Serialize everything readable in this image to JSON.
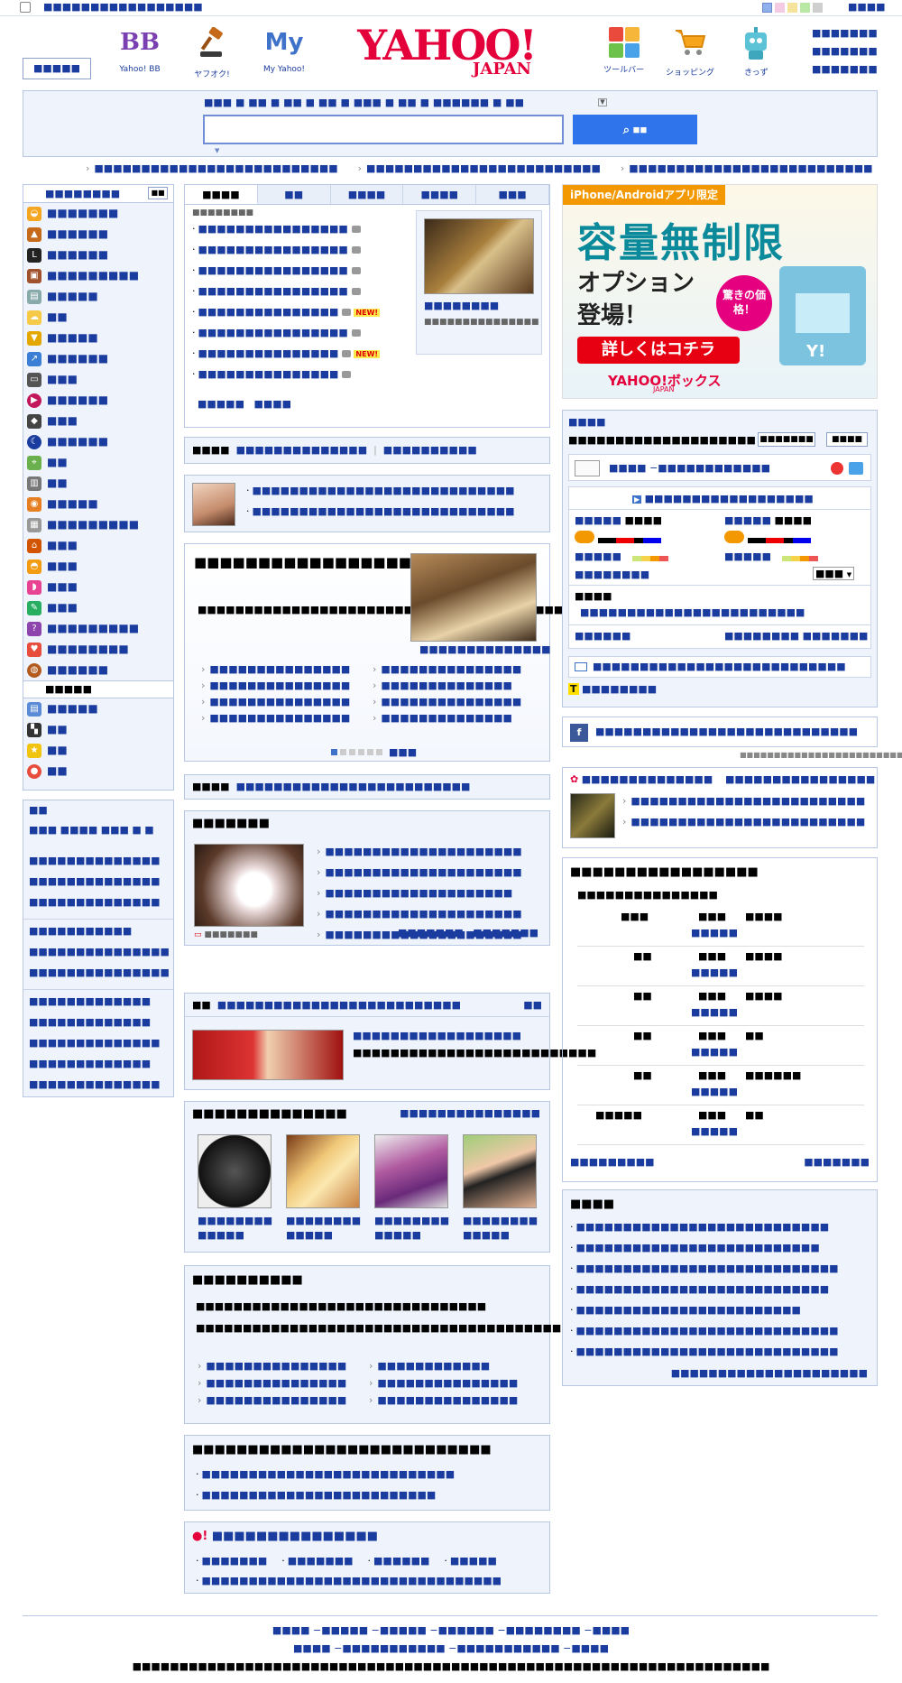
{
  "topbar": {
    "home_label": "■■■■■■■■■■■■■■■■■",
    "right_label": "■■■■"
  },
  "header": {
    "left_button": "■■■■■",
    "services": [
      {
        "label": "Yahoo! BB",
        "mark": "BB"
      },
      {
        "label": "ヤフオク!",
        "mark": ""
      },
      {
        "label": "My Yahoo!",
        "mark": "My"
      }
    ],
    "logo_main": "YAHOO!",
    "logo_sub": "JAPAN",
    "right_services": [
      {
        "label": "ツールバー"
      },
      {
        "label": "ショッピング"
      },
      {
        "label": "きっず"
      }
    ],
    "right_links": [
      "■■■■■■■",
      "■■■■■■■",
      "■■■■■■■"
    ]
  },
  "search": {
    "tabs": "■■■ ■ ■■ ■ ■■ ■ ■■ ■ ■■■ ■ ■■ ■ ■■■■■■ ■ ■■",
    "button": "■■",
    "value": ""
  },
  "promos": [
    "■■■■■■■■■■■■■■■■■■■■■■■■■■",
    "■■■■■■■■■■■■■■■■■■■■■■■■■",
    "■■■■■■■■■■■■■■■■■■■■■■■■■■"
  ],
  "sidebar": {
    "title": "■■■■■■■■",
    "title_btn": "■■",
    "items": [
      "■■■■■■■",
      "■■■■■■",
      "■■■■■■",
      "■■■■■■■■■",
      "■■■■■",
      "■■",
      "■■■■■",
      "■■■■■■",
      "■■■",
      "■■■■■■",
      "■■■",
      "■■■■■■",
      "■■",
      "■■",
      "■■■■■",
      "■■■■■■■■■",
      "■■■",
      "■■■",
      "■■■",
      "■■■",
      "■■■■■■■■■",
      "■■■■■■■■",
      "■■■■■■"
    ],
    "sub_title": "■■■■■",
    "sub_items": [
      "■■■■■",
      "■■",
      "■■",
      "■■"
    ]
  },
  "sidebar2": {
    "title": "■■",
    "line": "■■■ ■■■■ ■■■ ■ ■",
    "links": [
      "■■■■■■■■■■■■■■",
      "■■■■■■■■■■■■■■",
      "■■■■■■■■■■■■■■",
      "■■■■■■■■■■■",
      "■■■■■■■■■■■■■■■",
      "■■■■■■■■■■■■■■■",
      "■■■■■■■■■■■■■",
      "■■■■■■■■■■■■■",
      "■■■■■■■■■■■■■■",
      "■■■■■■■■■■■■■",
      "■■■■■■■■■■■■■■"
    ]
  },
  "news": {
    "tabs": [
      "■■■■",
      "■■",
      "■■■■",
      "■■■■",
      "■■■"
    ],
    "sub": "■■■■■■■■",
    "items": [
      {
        "t": "■■■■■■■■■■■■■■■■",
        "new": false
      },
      {
        "t": "■■■■■■■■■■■■■■■■",
        "new": false
      },
      {
        "t": "■■■■■■■■■■■■■■■■",
        "new": false
      },
      {
        "t": "■■■■■■■■■■■■■■■■",
        "new": false
      },
      {
        "t": "■■■■■■■■■■■■■■■",
        "new": true
      },
      {
        "t": "■■■■■■■■■■■■■■■■",
        "new": false
      },
      {
        "t": "■■■■■■■■■■■■■■■",
        "new": true
      },
      {
        "t": "■■■■■■■■■■■■■■■",
        "new": false
      }
    ],
    "new_label": "NEW!",
    "photo_caption": "■■■■■■■■",
    "photo_sub": "■■■■■■■■■■■■■■■",
    "more1": "■■■■■",
    "more2": "■■■■"
  },
  "topics_bar": {
    "label": "■■■■",
    "link1": "■■■■■■■■■■■■■■",
    "link2": "■■■■■■■■■■"
  },
  "person_box": {
    "links": [
      "■■■■■■■■■■■■■■■■■■■■■■■■■■■■",
      "■■■■■■■■■■■■■■■■■■■■■■■■■■■■"
    ]
  },
  "feature": {
    "title": "■■■■■■■■■■■■■■■■■■■■■■",
    "body": "■■■■■■■■■■■■■■■■■■■■■■■■■■■■■■■■■■■■■■■■■■■■■■■",
    "caption": "■■■■■■■■■■■■■■",
    "links": [
      "■■■■■■■■■■■■■■■",
      "■■■■■■■■■■■■■■■",
      "■■■■■■■■■■■■■■■",
      "■■■■■■■■■■■■■■",
      "■■■■■■■■■■■■■■■",
      "■■■■■■■■■■■■■■■",
      "■■■■■■■■■■■■■■■",
      "■■■■■■■■■■■■■■"
    ],
    "page": "■■■"
  },
  "bar2": {
    "label": "■■■■",
    "link": "■■■■■■■■■■■■■■■■■■■■■■■■■"
  },
  "video": {
    "title": "■■■■■■■",
    "tag": "■■■■■■■",
    "links": [
      "■■■■■■■■■■■■■■■■■■■■■",
      "■■■■■■■■■■■■■■■■■■■■■",
      "■■■■■■■■■■■■■■■■■■■■",
      "■■■■■■■■■■■■■■■■■■■■■",
      "■■■■■■■■■■■■■■■■■■■■■"
    ],
    "more1": "■■■■■■■",
    "more2": "■■■■■■■"
  },
  "tv": {
    "label": "■■",
    "link": "■■■■■■■■■■■■■■■■■■■■■■■■■■",
    "more": "■■",
    "title": "■■■■■■■■■■■■■■■■■■",
    "desc": "■■■■■■■■■■■■■■■■■■■■■■■■■■"
  },
  "shopping": {
    "title": "■■■■■■■■■■■■■■",
    "more": "■■■■■■■■■■■■■■■",
    "items": [
      {
        "a": "■■■■■■■■",
        "b": "■■■■■"
      },
      {
        "a": "■■■■■■■■",
        "b": "■■■■■"
      },
      {
        "a": "■■■■■■■■",
        "b": "■■■■■"
      },
      {
        "a": "■■■■■■■■",
        "b": "■■■■■"
      }
    ]
  },
  "column": {
    "title": "■■■■■■■■■■",
    "lines": [
      "■■■■■■■■■■■■■■■■■■■■■■■■■■■■■■■",
      "■■■■■■■■■■■■■■■■■■■■■■■■■■■■■■■■■■■■■■■■■■■■■■■■■■■■■■■"
    ],
    "links": [
      "■■■■■■■■■■■■■■■",
      "■■■■■■■■■■■■",
      "■■■■■■■■■■■■■■■",
      "■■■■■■■■■■■■■■■",
      "■■■■■■■■■■■■■■■",
      "■■■■■■■■■■■■■■■"
    ]
  },
  "ranking": {
    "title": "■■■■■■■■■■■■■■■■■■■■■■■■■■■",
    "links": [
      "■■■■■■■■■■■■■■■■■■■■■■■■■■■",
      "■■■■■■■■■■■■■■■■■■■■■■■■■"
    ]
  },
  "bottombox": {
    "title": "■■■■■■■■■■■■■■■",
    "row1": [
      "■■■■■■■",
      "■■■■■■■",
      "■■■■■■",
      "■■■■■"
    ],
    "row2": "■■■■■■■■■■■■■■■■■■■■■■■■■■■■■■■■"
  },
  "right": {
    "banner": {
      "tag": "iPhone/Androidアプリ限定",
      "line1": "容量無制限",
      "line2": "オプション",
      "line3": "登場！",
      "badge": "驚きの価格！",
      "cta": "詳しくはコチラ",
      "brand": "YAHOO!ボックス",
      "sub": "JAPAN"
    },
    "login": {
      "title": "■■■■",
      "desc": "■■■■■■■■■■■■■■■■■■■■",
      "btn1": "■■■■■■■",
      "btn2": "■■■■"
    },
    "mail": {
      "label": "■■■■ −■■■■■■■■■■■■"
    },
    "weather": {
      "title": "■■■■■■■■■■■■■■■■■■",
      "l1": "■■■■■",
      "l2": "■■■■",
      "r1": "■■■■■",
      "r2": "■■■■",
      "sub1": "■■■■■",
      "sub2": "■■■■■",
      "pref": "■■■■■■■■",
      "pref_val": "■■■",
      "area_label": "■■■■",
      "area_link": "■■■■■■■■■■■■■■■■■■■■■■■■",
      "foot1": "■■■■■■",
      "foot2": "■■■■■■■■ ■■■■■■■"
    },
    "traffic": {
      "label": "■■■■■■■■■■■■■■■■■■■■■■■■■■■"
    },
    "tpoint": {
      "label": "■■■■■■■■"
    },
    "fb": {
      "label": "■■■■■■■■■■■■■■■■■■■■■■■■■■■■",
      "footer": "■■■■■■■■■■■■■■■■■■■■■■■■"
    },
    "game": {
      "title": "■■■■■■■■■■■■■■",
      "more": "■■■■■■■■■■■■■■■■",
      "links": [
        "■■■■■■■■■■■■■■■■■■■■■■■■■",
        "■■■■■■■■■■■■■■■■■■■■■■■■■"
      ]
    },
    "sched": {
      "title": "■■■■■■■■■■■■■■■■■",
      "head": "■■■■■■■■■■■■■■■",
      "rows": [
        [
          "■■■",
          "■■■",
          "■■■■",
          "■■■■■"
        ],
        [
          "■■",
          "■■■",
          "■■■■",
          "■■■■■"
        ],
        [
          "■■",
          "■■■",
          "■■■■",
          "■■■■■"
        ],
        [
          "■■",
          "■■■",
          "■■",
          "■■■■■"
        ],
        [
          "■■",
          "■■■",
          "■■■■■■",
          "■■■■■"
        ],
        [
          "■■■■■",
          "■■■",
          "■■",
          "■■■■■"
        ]
      ],
      "foot1": "■■■■■■■■■",
      "foot2": "■■■■■■■"
    },
    "news2": {
      "title": "■■■■",
      "links": [
        "■■■■■■■■■■■■■■■■■■■■■■■■■■■",
        "■■■■■■■■■■■■■■■■■■■■■■■■■■",
        "■■■■■■■■■■■■■■■■■■■■■■■■■■■■",
        "■■■■■■■■■■■■■■■■■■■■■■■■■■■",
        "■■■■■■■■■■■■■■■■■■■■■■■■",
        "■■■■■■■■■■■■■■■■■■■■■■■■■■■■",
        "■■■■■■■■■■■■■■■■■■■■■■■■■■■■"
      ],
      "more": "■■■■■■■■■■■■■■■■■■■■■"
    }
  },
  "footer": {
    "line1": "■■■■ −■■■■■ −■■■■■ −■■■■■■ −■■■■■■■■ −■■■■",
    "line2": "■■■■ −■■■■■■■■■■■ −■■■■■■■■■■■ −■■■■",
    "copyright": "■■■■■■■■■■■■■■■■■■■■■■■■■■■■■■■■■■■■■■■■■■■■■■■■■■■■■■■■■■■■■■■■■■■■"
  }
}
